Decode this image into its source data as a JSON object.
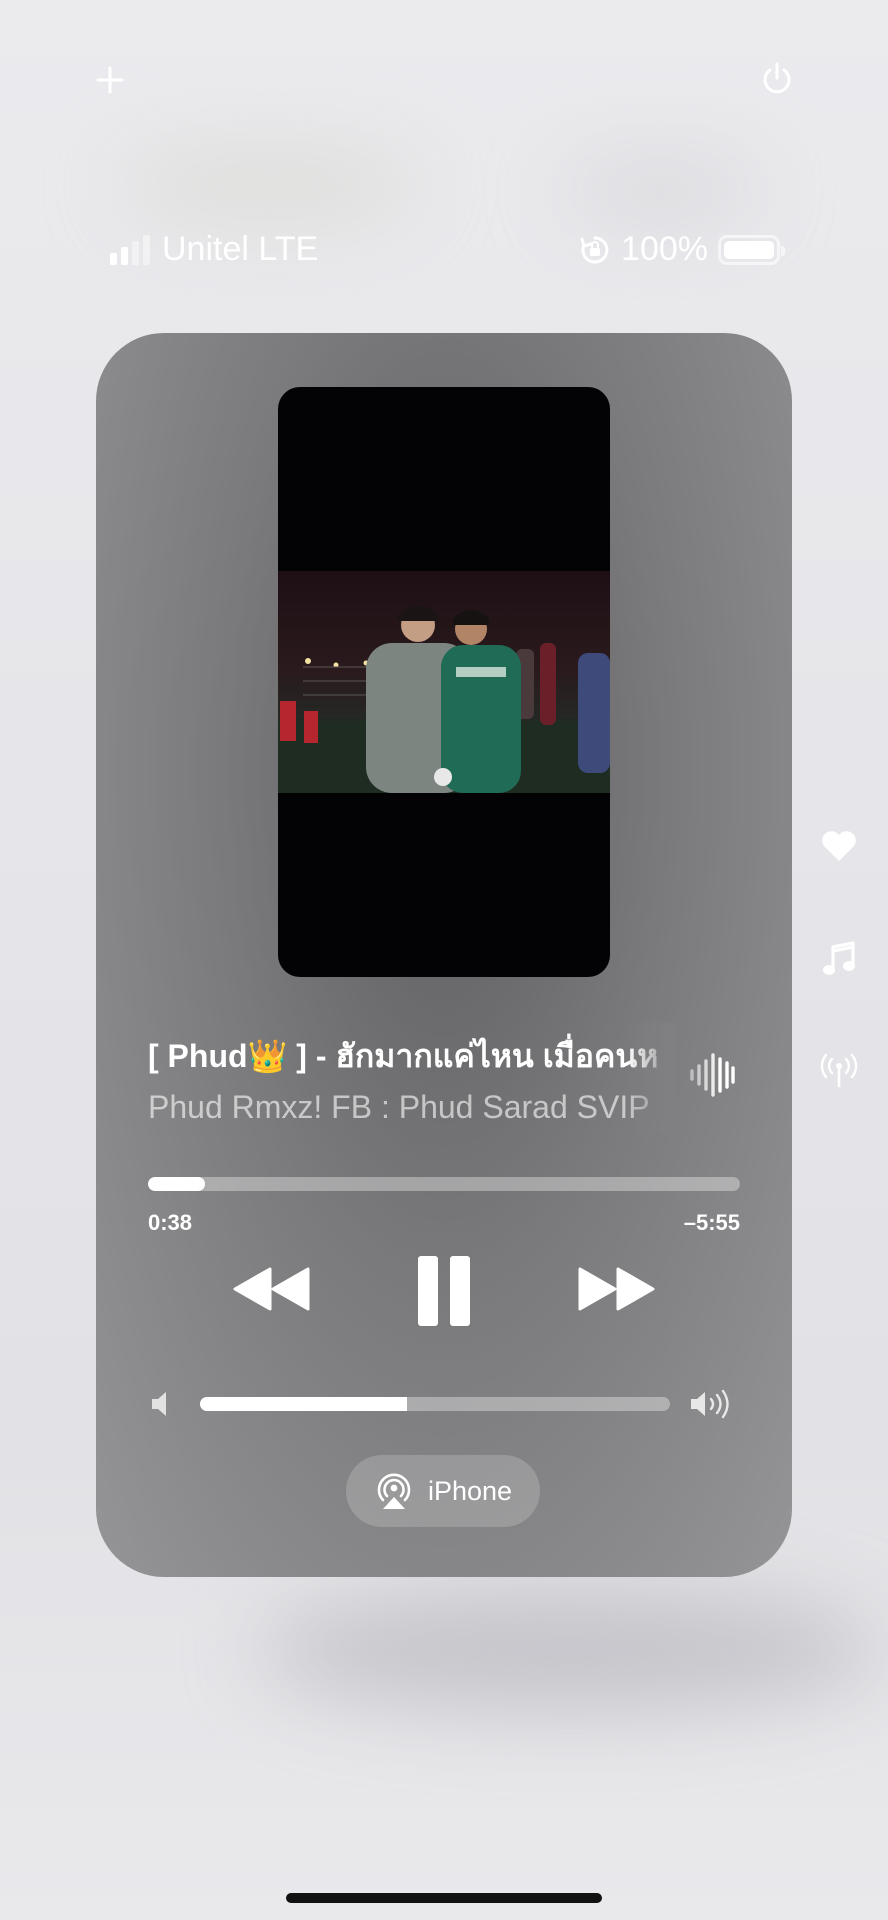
{
  "status_bar": {
    "carrier": "Unitel LTE",
    "signal_bars_filled": 2,
    "signal_bars_total": 4,
    "battery_percent_label": "100%",
    "battery_level": 1.0,
    "rotation_lock_icon": "rotation-lock-icon"
  },
  "top_controls": {
    "add_icon": "plus-icon",
    "power_icon": "power-icon"
  },
  "side_controls": [
    "heart-icon",
    "music-note-icon",
    "antenna-icon"
  ],
  "now_playing": {
    "title": "[ Phud👑 ] - ฮักมากแค่ไหน เมื่อคนห",
    "artist": "Phud Rmxz! FB : Phud Sarad SVIP",
    "elapsed": "0:38",
    "remaining": "–5:55",
    "progress_fraction": 0.097,
    "volume_fraction": 0.44,
    "audio_output": "iPhone",
    "waveform_icon": "waveform-icon"
  },
  "colors": {
    "card_center": "#5e5e60",
    "card_edge": "#959597",
    "accent": "#ffffff"
  }
}
